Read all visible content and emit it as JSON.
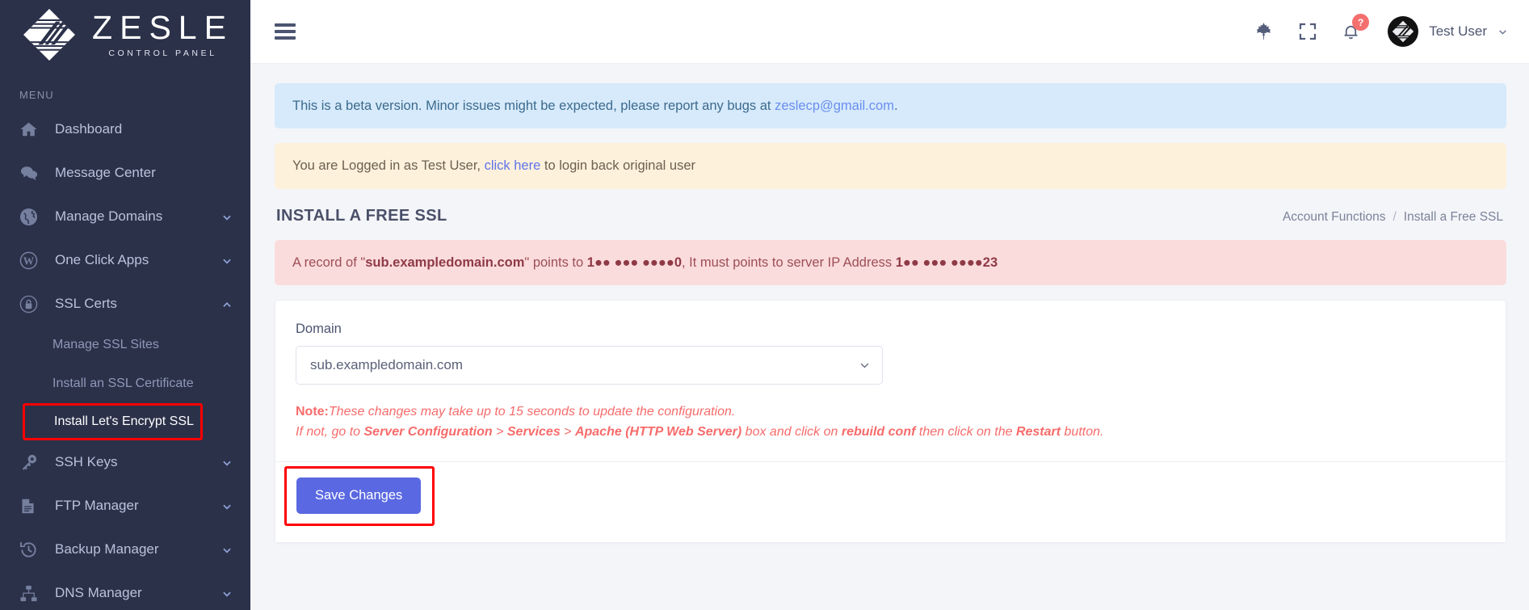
{
  "brand": {
    "name": "ZESLE",
    "tagline": "CONTROL PANEL",
    "logo_icon": "zesle-diamond-logo"
  },
  "sidebar": {
    "section_label": "MENU",
    "items": [
      {
        "label": "Dashboard",
        "icon": "home-icon",
        "expandable": false
      },
      {
        "label": "Message Center",
        "icon": "chat-icon",
        "expandable": false
      },
      {
        "label": "Manage Domains",
        "icon": "globe-icon",
        "expandable": true,
        "expanded": false
      },
      {
        "label": "One Click Apps",
        "icon": "wordpress-icon",
        "expandable": true,
        "expanded": false
      },
      {
        "label": "SSL Certs",
        "icon": "lock-icon",
        "expandable": true,
        "expanded": true
      },
      {
        "label": "SSH Keys",
        "icon": "key-icon",
        "expandable": true,
        "expanded": false
      },
      {
        "label": "FTP Manager",
        "icon": "file-icon",
        "expandable": true,
        "expanded": false
      },
      {
        "label": "Backup Manager",
        "icon": "history-icon",
        "expandable": true,
        "expanded": false
      },
      {
        "label": "DNS Manager",
        "icon": "sitemap-icon",
        "expandable": true,
        "expanded": false
      }
    ],
    "ssl_subitems": [
      {
        "label": "Manage SSL Sites",
        "active": false
      },
      {
        "label": "Install an SSL Certificate",
        "active": false
      },
      {
        "label": "Install Let's Encrypt SSL",
        "active": true,
        "highlighted": true
      }
    ]
  },
  "topbar": {
    "menu_toggle_icon": "hamburger-icon",
    "leaf_icon": "maple-leaf-icon",
    "fullscreen_icon": "fullscreen-expand-icon",
    "notification_icon": "bell-icon",
    "notification_badge": "?",
    "avatar_icon": "user-avatar-zesle",
    "user_name": "Test User",
    "user_chevron_icon": "chevron-down-icon"
  },
  "alerts": {
    "beta": {
      "text_before": "This is a beta version. Minor issues might be expected, please report any bugs at ",
      "link": "zeslecp@gmail.com",
      "text_after": "."
    },
    "impersonation": {
      "text_before": "You are Logged in as Test User, ",
      "link": "click here",
      "text_after": " to login back original user"
    },
    "dns_error": {
      "prefix": "A record of \"",
      "domain": "sub.exampledomain.com",
      "middle": "\" points to ",
      "current_ip": "1●● ●●● ●●●●0",
      "middle2": ", It must points to server IP Address ",
      "required_ip": "1●● ●●● ●●●●23"
    }
  },
  "page": {
    "title": "INSTALL A FREE SSL",
    "breadcrumb": {
      "parent": "Account Functions",
      "separator": "/",
      "current": "Install a Free SSL"
    }
  },
  "form": {
    "domain_label": "Domain",
    "domain_value": "sub.exampledomain.com",
    "domain_options": [
      "sub.exampledomain.com"
    ],
    "dropdown_icon": "chevron-down-icon",
    "note": {
      "label": "Note:",
      "line1": "These changes may take up to 15 seconds to update the configuration.",
      "line2_a": "If not, go to ",
      "line2_b1": "Server Configuration",
      "line2_sep1": " > ",
      "line2_b2": "Services",
      "line2_sep2": " > ",
      "line2_b3": "Apache (HTTP Web Server)",
      "line2_c": " box and click on ",
      "line2_b4": "rebuild conf",
      "line2_d": " then click on the ",
      "line2_b5": "Restart",
      "line2_e": " button."
    },
    "save_label": "Save Changes"
  },
  "colors": {
    "sidebar_bg": "#2b3149",
    "accent_primary": "#5a68e2",
    "annotation_red": "#fd0000",
    "alert_info_bg": "#d6eafb",
    "alert_warn_bg": "#fdf1dc",
    "alert_danger_bg": "#fbdcdd",
    "note_red": "#f86b6b",
    "badge_red": "#f4706f"
  }
}
